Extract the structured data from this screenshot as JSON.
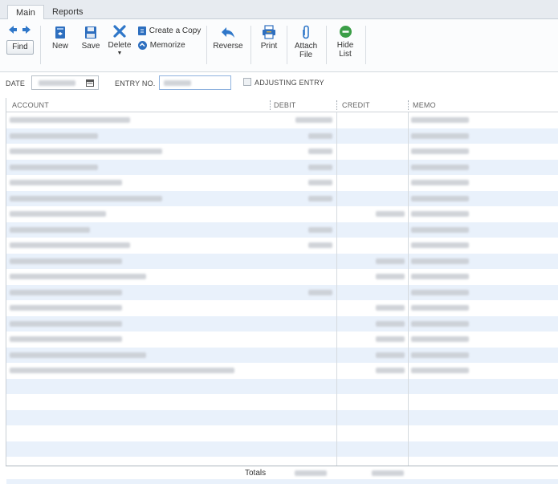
{
  "tabs": [
    {
      "label": "Main",
      "active": true
    },
    {
      "label": "Reports",
      "active": false
    }
  ],
  "toolbar": {
    "find": "Find",
    "new": "New",
    "save": "Save",
    "delete": "Delete",
    "create_copy": "Create a Copy",
    "memorize": "Memorize",
    "reverse": "Reverse",
    "print": "Print",
    "attach_line1": "Attach",
    "attach_line2": "File",
    "hide_line1": "Hide",
    "hide_line2": "List"
  },
  "form": {
    "date_label": "DATE",
    "entry_no_label": "ENTRY NO.",
    "adjusting_label": "ADJUSTING ENTRY",
    "adjusting_checked": false
  },
  "grid": {
    "columns": [
      "ACCOUNT",
      "DEBIT",
      "CREDIT",
      "MEMO"
    ],
    "row_count_filled": 17,
    "row_count_empty": 7,
    "totals_label": "Totals"
  },
  "colors": {
    "accent_blue": "#3a7bd5",
    "row_alt": "#e9f1fb",
    "hide_list_green": "#3b9e47"
  }
}
